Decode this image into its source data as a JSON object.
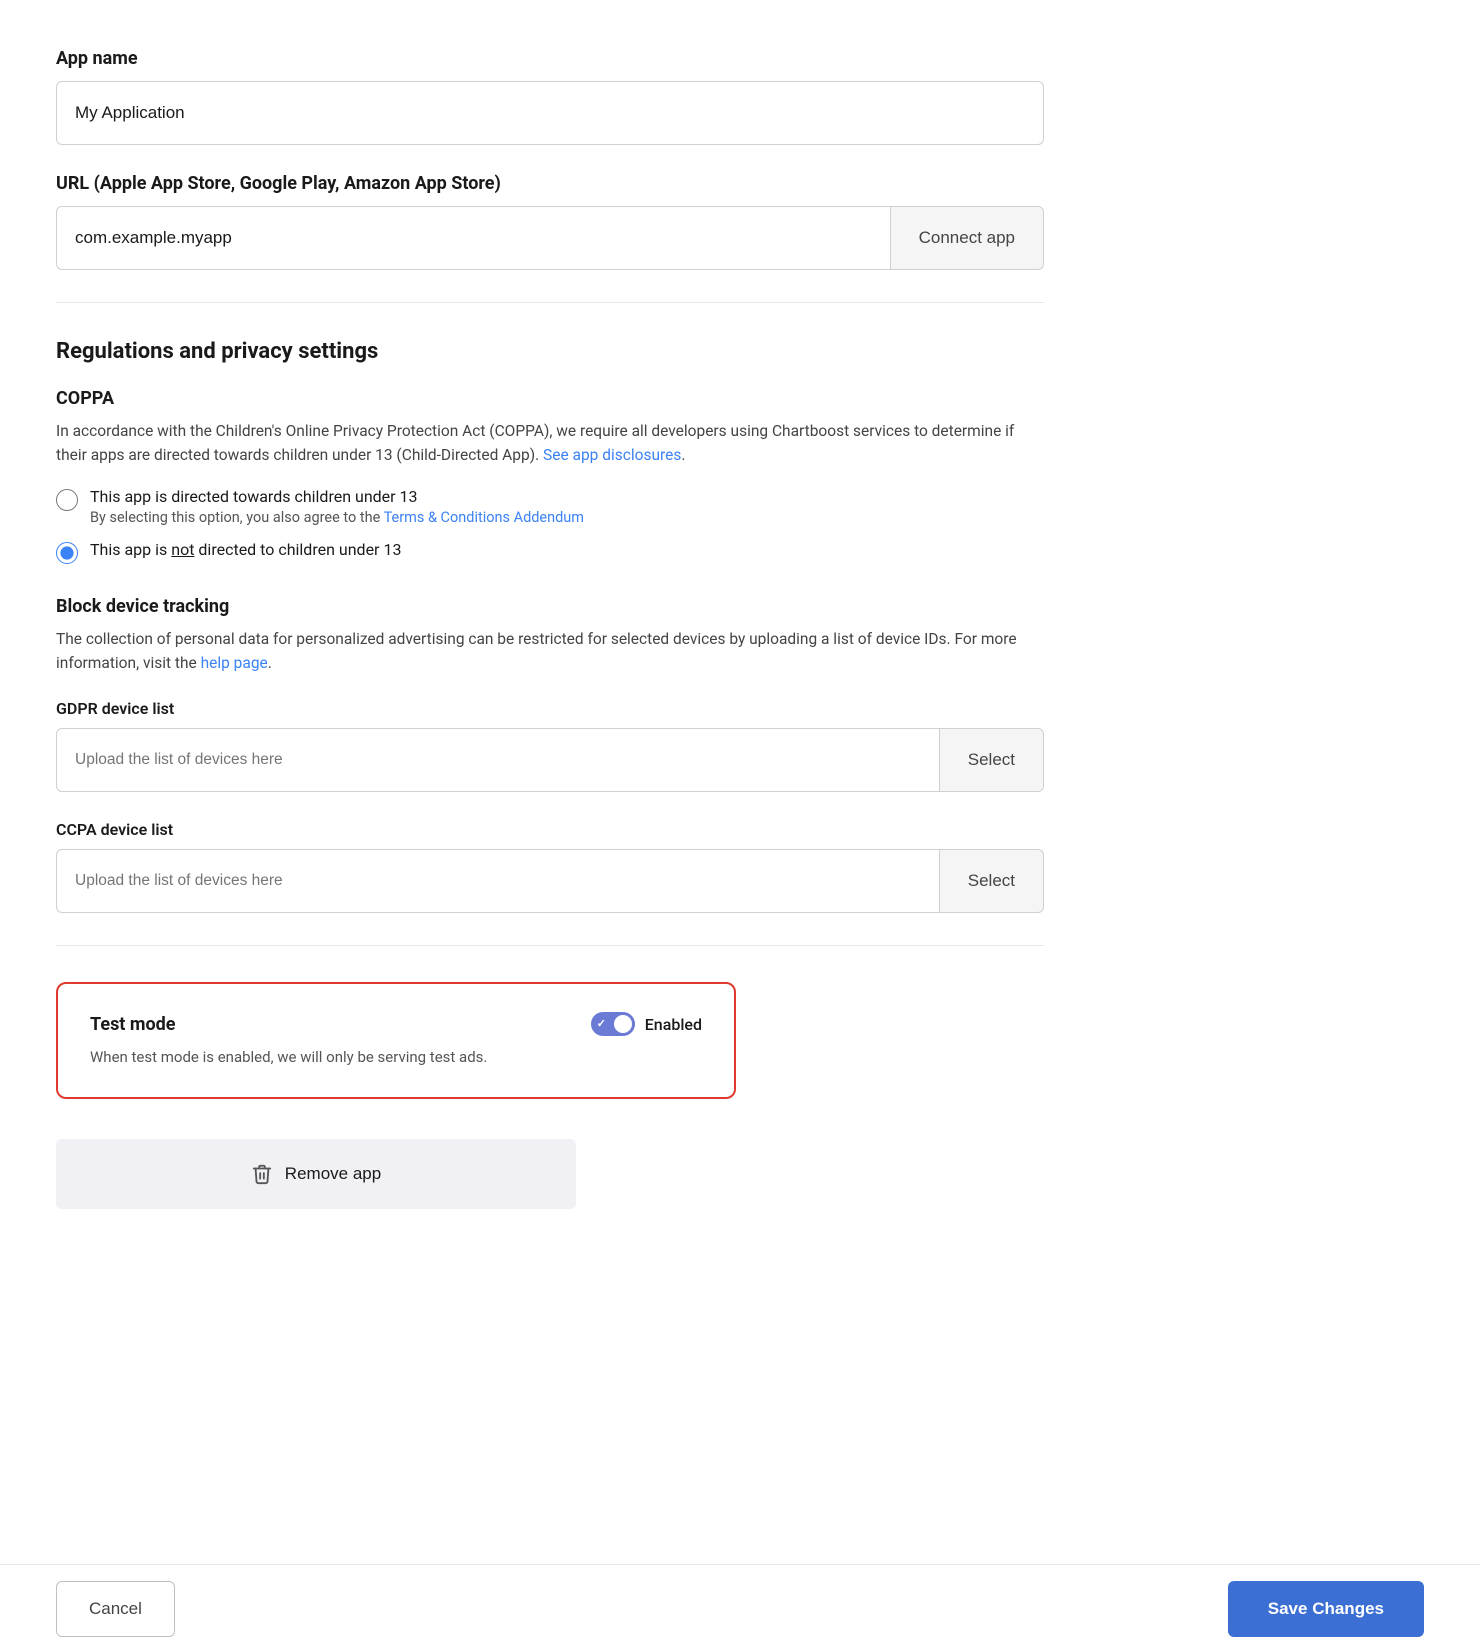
{
  "app_name": {
    "label": "App name",
    "value": "My Application",
    "placeholder": "My Application"
  },
  "url": {
    "label": "URL (Apple App Store, Google Play, Amazon App Store)",
    "value": "com.example.myapp",
    "placeholder": "com.example.myapp",
    "connect_btn_label": "Connect app"
  },
  "regulations": {
    "section_title": "Regulations and privacy settings",
    "coppa": {
      "subtitle": "COPPA",
      "description_part1": "In accordance with the Children's Online Privacy Protection Act (COPPA), we require all developers using Chartboost services to determine if their apps are directed towards children under 13 (Child-Directed App). ",
      "description_link": "See app disclosures",
      "radio_option1": {
        "label": "This app is directed towards children under 13",
        "sublabel_part1": "By selecting this option, you also agree to the ",
        "sublabel_link": "Terms & Conditions Addendum",
        "checked": false
      },
      "radio_option2": {
        "label_before_not": "This app is ",
        "label_not": "not",
        "label_after": " directed to children under 13",
        "checked": true
      }
    },
    "block_tracking": {
      "subtitle": "Block device tracking",
      "description_part1": "The collection of personal data for personalized advertising can be restricted for selected devices by uploading a list of device IDs. For more information, visit the ",
      "description_link": "help page",
      "gdpr": {
        "label": "GDPR device list",
        "placeholder": "Upload the list of devices here",
        "select_btn": "Select"
      },
      "ccpa": {
        "label": "CCPA device list",
        "placeholder": "Upload the list of devices here",
        "select_btn": "Select"
      }
    }
  },
  "test_mode": {
    "title": "Test mode",
    "toggle_label": "Enabled",
    "enabled": true,
    "description": "When test mode is enabled, we will only be serving test ads."
  },
  "remove_app": {
    "label": "Remove app"
  },
  "footer": {
    "cancel_label": "Cancel",
    "save_label": "Save Changes"
  }
}
